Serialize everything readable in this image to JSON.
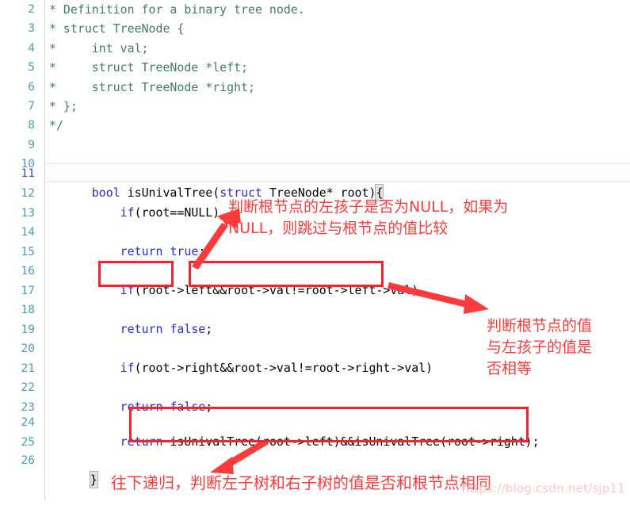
{
  "editor": {
    "language": "c",
    "first_line_number": 2,
    "current_line": 11,
    "gutter_color": "#4a9bbd",
    "current_line_number_color": "#4a4ab4",
    "comment_color": "#3f7f5f",
    "keyword_color": "#2929d6",
    "lines": [
      {
        "n": "2",
        "indent": 0,
        "kind": "comment",
        "text": "* Definition for a binary tree node."
      },
      {
        "n": "3",
        "indent": 0,
        "kind": "comment",
        "text": "* struct TreeNode {"
      },
      {
        "n": "4",
        "indent": 0,
        "kind": "comment",
        "text": "*     int val;"
      },
      {
        "n": "5",
        "indent": 0,
        "kind": "comment",
        "text": "*     struct TreeNode *left;"
      },
      {
        "n": "6",
        "indent": 0,
        "kind": "comment",
        "text": "*     struct TreeNode *right;"
      },
      {
        "n": "7",
        "indent": 0,
        "kind": "comment",
        "text": "* };"
      },
      {
        "n": "8",
        "indent": 0,
        "kind": "comment",
        "text": "*/"
      },
      {
        "n": "9",
        "indent": 0,
        "kind": "blank",
        "text": ""
      },
      {
        "n": "10",
        "indent": 0,
        "kind": "blank",
        "text": ""
      },
      {
        "n": "11",
        "indent": 0,
        "kind": "code",
        "text": "bool isUnivalTree(struct TreeNode* root){"
      },
      {
        "n": "12",
        "indent": 0,
        "kind": "code",
        "text": "    if(root==NULL)"
      },
      {
        "n": "13",
        "indent": 0,
        "kind": "blank",
        "text": ""
      },
      {
        "n": "14",
        "indent": 0,
        "kind": "code",
        "text": "    return true;"
      },
      {
        "n": "15",
        "indent": 0,
        "kind": "blank",
        "text": ""
      },
      {
        "n": "16",
        "indent": 0,
        "kind": "code",
        "text": "    if(root->left&&root->val!=root->left->val)"
      },
      {
        "n": "17",
        "indent": 0,
        "kind": "blank",
        "text": ""
      },
      {
        "n": "18",
        "indent": 0,
        "kind": "code",
        "text": "    return false;"
      },
      {
        "n": "19",
        "indent": 0,
        "kind": "blank",
        "text": ""
      },
      {
        "n": "20",
        "indent": 0,
        "kind": "code",
        "text": "    if(root->right&&root->val!=root->right->val)"
      },
      {
        "n": "21",
        "indent": 0,
        "kind": "blank",
        "text": ""
      },
      {
        "n": "22",
        "indent": 0,
        "kind": "code",
        "text": "    return false;"
      },
      {
        "n": "23",
        "indent": 0,
        "kind": "blank",
        "text": ""
      },
      {
        "n": "24",
        "indent": 0,
        "kind": "code",
        "text": "    return isUnivalTree(root->left)&&isUnivalTree(root->right);"
      },
      {
        "n": "25",
        "indent": 0,
        "kind": "blank",
        "text": ""
      },
      {
        "n": "26",
        "indent": 0,
        "kind": "code",
        "text": "}"
      }
    ]
  },
  "annotations": {
    "color": "#fb3b3b",
    "note_left_child_null": "判断根节点的左孩子是否为NULL，如果为\nNULL，则跳过与根节点的值比较",
    "note_value_equal": "判断根节点的值\n与左孩子的值是\n否相等",
    "note_recursion": "往下递归，判断左子树和右子树的值是否和根节点相同",
    "boxes": [
      {
        "name": "box-root-left-check"
      },
      {
        "name": "box-val-compare"
      },
      {
        "name": "box-recursive-return"
      }
    ],
    "arrows": [
      {
        "name": "arrow-to-left-child-note"
      },
      {
        "name": "arrow-to-value-equal-note"
      },
      {
        "name": "arrow-to-recursion-note"
      }
    ]
  },
  "watermark": {
    "text": "https://blog.csdn.net/sjp11"
  }
}
